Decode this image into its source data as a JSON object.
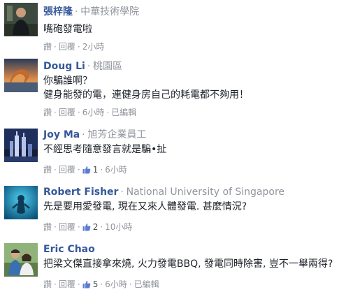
{
  "actions": {
    "like": "讚",
    "reply": "回覆",
    "edited": "已編輯",
    "dot": "·"
  },
  "colors": {
    "name": "#365899",
    "meta": "#90949c",
    "text": "#1d2129",
    "like": "#5b7bd5"
  },
  "comments": [
    {
      "name": "張梓隆",
      "affiliation": "中華技術學院",
      "lines": [
        "嘴砲發電啦"
      ],
      "likes": "",
      "time": "2小時",
      "edited": false,
      "avatar": "person-photo-avatar"
    },
    {
      "name": "Doug Li",
      "affiliation": "桃園區",
      "lines": [
        "你騙誰啊？",
        "健身能發的電，連健身房自己的耗電都不夠用！"
      ],
      "likes": "",
      "time": "6小時",
      "edited": true,
      "avatar": "sunset-rock-avatar"
    },
    {
      "name": "Joy Ma",
      "affiliation": "旭芳企業員工",
      "lines": [
        "不經思考隨意發言就是騙•扯"
      ],
      "likes": "1",
      "time": "6小時",
      "edited": false,
      "avatar": "city-night-avatar"
    },
    {
      "name": "Robert Fisher",
      "affiliation": "National University of Singapore",
      "lines": [
        "先是要用愛發電, 現在又來人體發電. 甚麼情況?"
      ],
      "likes": "2",
      "time": "10小時",
      "edited": false,
      "avatar": "underwater-avatar"
    },
    {
      "name": "Eric Chao",
      "affiliation": "",
      "lines": [
        "把梁文傑直接拿來燒, 火力發電BBQ, 發電同時除害, 豈不一舉兩得?"
      ],
      "likes": "5",
      "time": "6小時",
      "edited": true,
      "avatar": "couple-photo-avatar"
    }
  ]
}
